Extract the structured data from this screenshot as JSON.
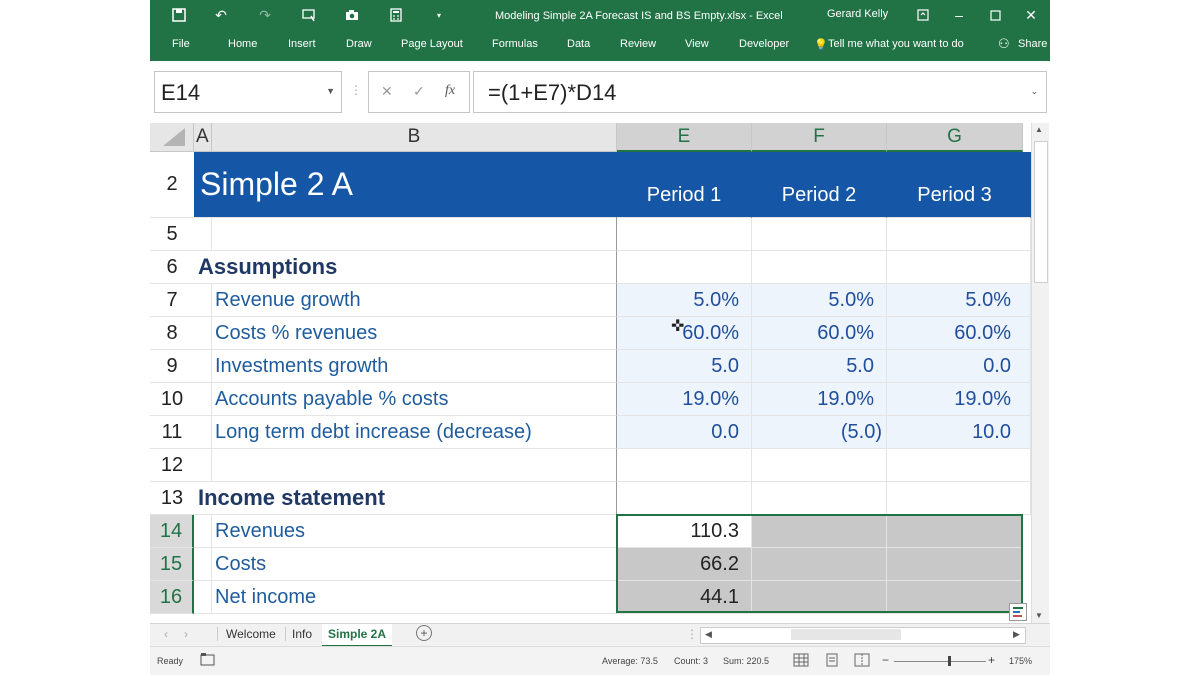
{
  "titlebar": {
    "title": "Modeling Simple 2A Forecast IS and BS Empty.xlsx  -  Excel",
    "user": "Gerard Kelly",
    "icons": [
      "save-icon",
      "undo-icon",
      "redo-icon",
      "touch-mode-icon",
      "camera-icon",
      "calculator-icon",
      "customize-qat-icon"
    ]
  },
  "ribbon": {
    "tabs": [
      "File",
      "Home",
      "Insert",
      "Draw",
      "Page Layout",
      "Formulas",
      "Data",
      "Review",
      "View",
      "Developer"
    ],
    "tell_me": "Tell me what you want to do",
    "share": "Share"
  },
  "formula_bar": {
    "name_box": "E14",
    "cancel": "✕",
    "enter": "✓",
    "fx": "fx",
    "formula": "=(1+E7)*D14"
  },
  "columns": [
    "A",
    "B",
    "E",
    "F",
    "G"
  ],
  "rows": [
    {
      "num": "2",
      "label": "Simple 2 A",
      "e": "Period 1",
      "f": "Period 2",
      "g": "Period 3"
    },
    {
      "num": "5",
      "label": "",
      "e": "",
      "f": "",
      "g": ""
    },
    {
      "num": "6",
      "label": "Assumptions",
      "e": "",
      "f": "",
      "g": ""
    },
    {
      "num": "7",
      "label": "Revenue growth",
      "e": "5.0%",
      "f": "5.0%",
      "g": "5.0%"
    },
    {
      "num": "8",
      "label": "Costs % revenues",
      "e": "60.0%",
      "f": "60.0%",
      "g": "60.0%"
    },
    {
      "num": "9",
      "label": "Investments growth",
      "e": "5.0",
      "f": "5.0",
      "g": "0.0"
    },
    {
      "num": "10",
      "label": "Accounts payable % costs",
      "e": "19.0%",
      "f": "19.0%",
      "g": "19.0%"
    },
    {
      "num": "11",
      "label": "Long term debt increase (decrease)",
      "e": "0.0",
      "f": "(5.0)",
      "g": "10.0"
    },
    {
      "num": "12",
      "label": "",
      "e": "",
      "f": "",
      "g": ""
    },
    {
      "num": "13",
      "label": "Income statement",
      "e": "",
      "f": "",
      "g": ""
    },
    {
      "num": "14",
      "label": "Revenues",
      "e": "110.3",
      "f": "",
      "g": ""
    },
    {
      "num": "15",
      "label": "Costs",
      "e": "66.2",
      "f": "",
      "g": ""
    },
    {
      "num": "16",
      "label": "Net income",
      "e": "44.1",
      "f": "",
      "g": ""
    }
  ],
  "sheet_tabs": [
    "Welcome",
    "Info",
    "Simple 2A"
  ],
  "active_sheet": "Simple 2A",
  "status": {
    "ready": "Ready",
    "average": "Average: 73.5",
    "count": "Count: 3",
    "sum": "Sum: 220.5",
    "zoom": "175%"
  },
  "colors": {
    "excel_green": "#217346",
    "header_band": "#1557a6",
    "label_blue": "#1f5c9e",
    "selection_grey": "#c8c8c8"
  }
}
